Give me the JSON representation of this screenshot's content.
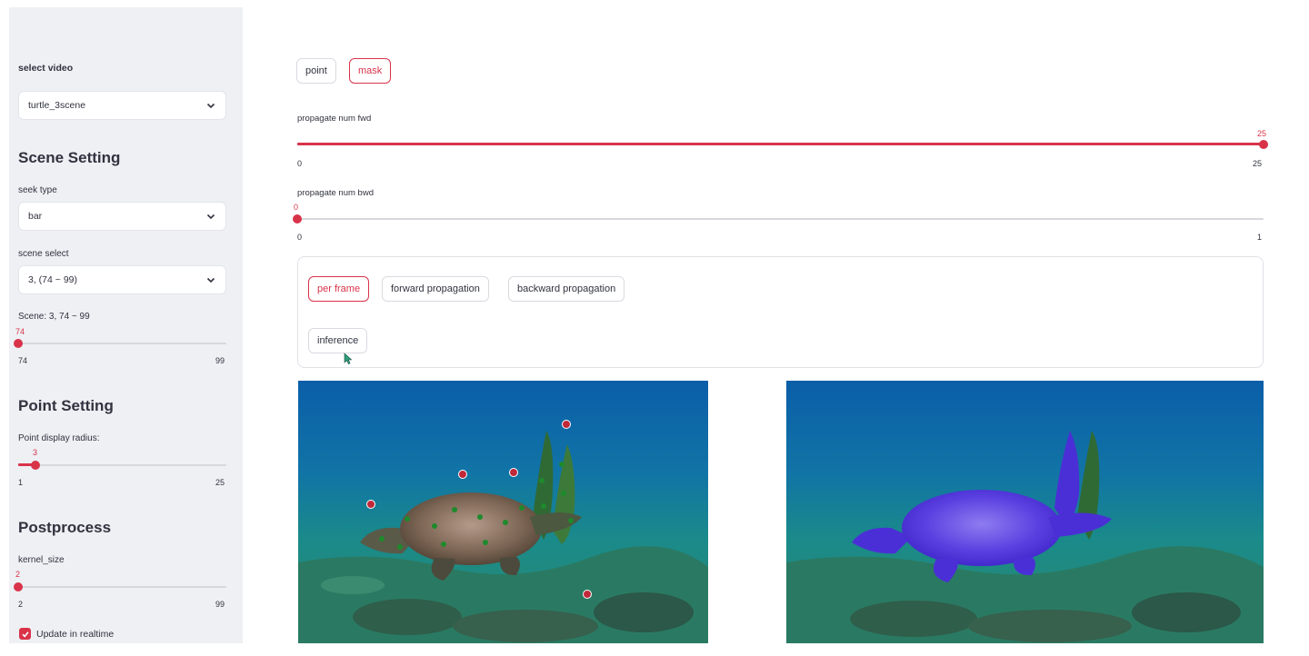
{
  "sidebar": {
    "select_video_label": "select video",
    "select_video_value": "turtle_3scene",
    "scene_setting_heading": "Scene Setting",
    "seek_type_label": "seek type",
    "seek_type_value": "bar",
    "scene_select_label": "scene select",
    "scene_select_value": "3, (74 ~ 99)",
    "scene_slider": {
      "label": "Scene: 3, 74 ~ 99",
      "value": "74",
      "min": "74",
      "max": "99",
      "fraction": 0.0
    },
    "point_setting_heading": "Point Setting",
    "point_radius_slider": {
      "label": "Point display radius:",
      "value": "3",
      "min": "1",
      "max": "25",
      "fraction": 0.083
    },
    "postprocess_heading": "Postprocess",
    "kernel_slider": {
      "label": "kernel_size",
      "value": "2",
      "min": "2",
      "max": "99",
      "fraction": 0.0
    },
    "update_realtime_label": "Update in realtime",
    "update_realtime_checked": true
  },
  "main": {
    "mode_buttons": [
      {
        "label": "point",
        "active": false
      },
      {
        "label": "mask",
        "active": true
      }
    ],
    "fwd_slider": {
      "label": "propagate num fwd",
      "value": "25",
      "min": "0",
      "max": "25",
      "fraction": 1.0
    },
    "bwd_slider": {
      "label": "propagate num bwd",
      "value": "0",
      "min": "0",
      "max": "1",
      "fraction": 0.0
    },
    "propagation_buttons": [
      {
        "label": "per frame",
        "active": true
      },
      {
        "label": "forward propagation",
        "active": false
      },
      {
        "label": "backward propagation",
        "active": false
      }
    ],
    "inference_label": "inference"
  },
  "colors": {
    "accent": "#d9334a",
    "sidebar_bg": "#eef0f4",
    "mask_overlay": "#4b2fd6",
    "point_marker": "#c0283a",
    "positive_point": "#1e8a2c"
  },
  "icons": {
    "select_chevron": "chevron-down-icon",
    "checkbox": "checkmark-icon",
    "cursor": "mouse-cursor-icon"
  }
}
